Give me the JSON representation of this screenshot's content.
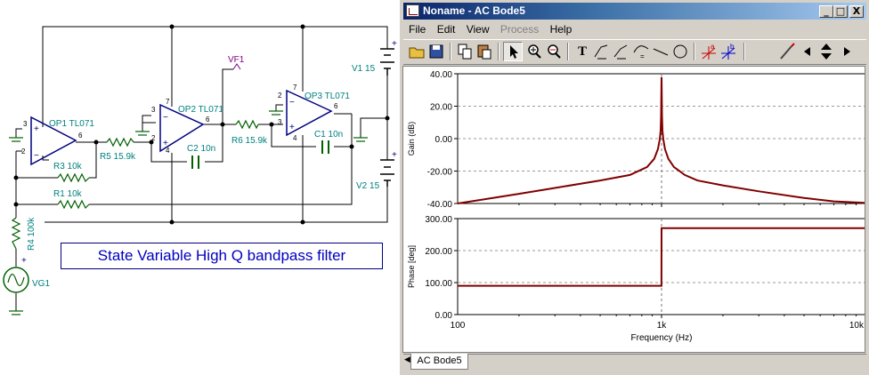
{
  "schematic": {
    "title": "State Variable High Q bandpass filter",
    "labels": {
      "op1": "OP1 TL071",
      "op2": "OP2 TL071",
      "op3": "OP3 TL071",
      "r5": "R5 15.9k",
      "r6": "R6 15.9k",
      "r3": "R3 10k",
      "r1": "R1 10k",
      "r4": "R4 100k",
      "c1": "C1 10n",
      "c2": "C2 10n",
      "v1": "V1 15",
      "v2": "V2 15",
      "vg1": "VG1",
      "vf1": "VF1"
    },
    "pins": {
      "p3": "3",
      "p2": "2",
      "p6": "6",
      "p4": "4",
      "p7": "7",
      "plus": "+",
      "minus": "−"
    }
  },
  "window": {
    "title": "Noname - AC Bode5",
    "buttons": {
      "minimize": "_",
      "maximize": "□",
      "close": "X"
    },
    "menu": [
      "File",
      "Edit",
      "View",
      "Process",
      "Help"
    ],
    "toolbar": {
      "text_tool": "T"
    },
    "tab_label": "AC Bode5"
  },
  "chart_data": [
    {
      "type": "line",
      "title": "",
      "xlabel": "",
      "ylabel": "Gain (dB)",
      "xscale": "log",
      "xlim": [
        100,
        10000
      ],
      "ylim": [
        -40,
        40
      ],
      "yticks": [
        "40.00",
        "20.00",
        "0.00",
        "-20.00",
        "-40.00"
      ],
      "grid": true,
      "color": "#800000",
      "series": [
        {
          "x": [
            100,
            200,
            300,
            500,
            700,
            850,
            920,
            960,
            980,
            990,
            995,
            1000,
            1005,
            1010,
            1020,
            1040,
            1080,
            1150,
            1300,
            1500,
            2000,
            3000,
            5000,
            7000,
            10000
          ],
          "y": [
            -40.0,
            -34.0,
            -30.4,
            -25.8,
            -22.4,
            -17.5,
            -12.5,
            -6.5,
            -0.5,
            5.0,
            14.0,
            38.0,
            14.0,
            5.0,
            -0.5,
            -6.5,
            -12.5,
            -17.5,
            -22.4,
            -25.8,
            -28.8,
            -32.5,
            -36.6,
            -38.7,
            -39.6
          ]
        }
      ]
    },
    {
      "type": "line",
      "title": "",
      "xlabel": "Frequency (Hz)",
      "ylabel": "Phase [deg]",
      "xscale": "log",
      "xlim": [
        100,
        10000
      ],
      "ylim": [
        0,
        300
      ],
      "yticks": [
        "300.00",
        "200.00",
        "100.00",
        "0.00"
      ],
      "xticks": [
        "100",
        "1k",
        "10k"
      ],
      "grid": true,
      "color": "#800000",
      "series": [
        {
          "x": [
            100,
            999,
            1000,
            10000
          ],
          "y": [
            90,
            90,
            270,
            270
          ]
        }
      ]
    }
  ]
}
